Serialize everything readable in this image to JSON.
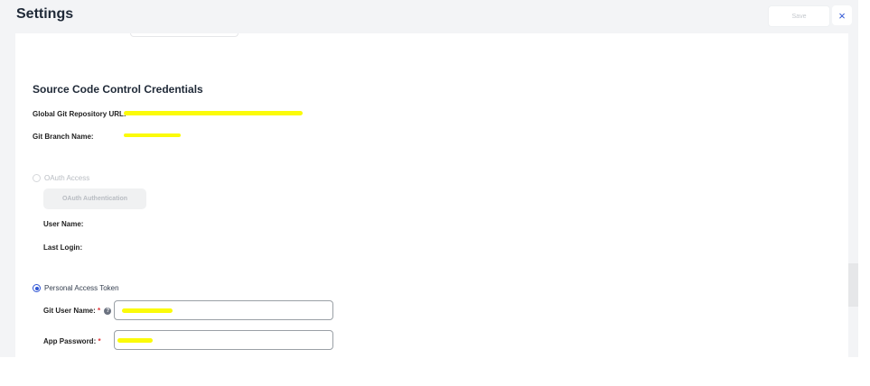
{
  "header": {
    "title": "Settings",
    "save_label": "Save",
    "close_label": "×"
  },
  "section": {
    "title": "Source Code Control Credentials"
  },
  "repo": {
    "url_label": "Global Git Repository URL:",
    "branch_label": "Git Branch Name:"
  },
  "oauth": {
    "label": "OAuth Access",
    "button_label": "OAuth Authentication",
    "user_name_label": "User Name:",
    "last_login_label": "Last Login:"
  },
  "token": {
    "label": "Personal Access Token",
    "git_user_label": "Git User Name:",
    "app_password_label": "App Password:",
    "required_mark": "*",
    "help_icon": "?"
  },
  "colors": {
    "accent": "#2f55d4",
    "required": "#e0353a",
    "redaction": "#fbfb09"
  }
}
